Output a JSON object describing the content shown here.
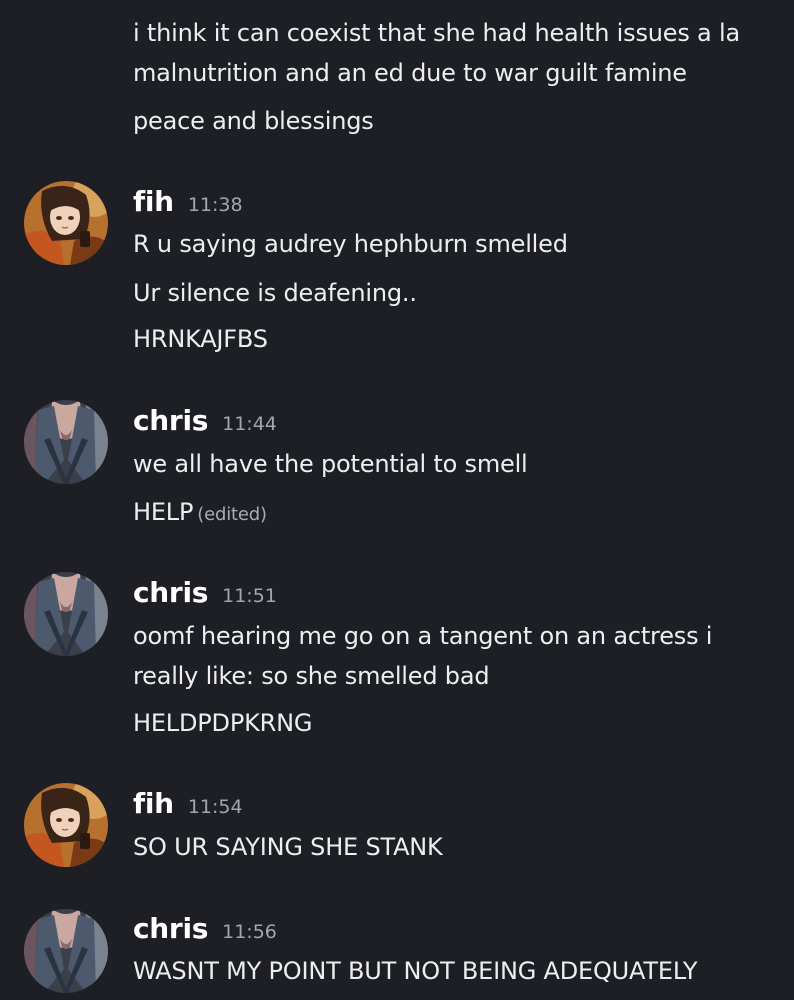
{
  "messages": [
    {
      "continuation": true,
      "lines": [
        {
          "text": "i think it can coexist that she had health issues a la"
        },
        {
          "text": "malnutrition and an ed due to war guilt famine"
        },
        {
          "text": "peace and blessings"
        }
      ]
    },
    {
      "username": "fih",
      "timestamp": "11:38",
      "avatar": "fih-avatar",
      "lines": [
        {
          "text": "R u saying audrey hephburn smelled"
        },
        {
          "text": "Ur silence is deafening.."
        },
        {
          "text": "HRNKAJFBS"
        }
      ]
    },
    {
      "username": "chris",
      "timestamp": "11:44",
      "avatar": "chris-avatar",
      "lines": [
        {
          "text": "we all have the potential to smell"
        },
        {
          "text": "HELP",
          "edited": "(edited)"
        }
      ]
    },
    {
      "username": "chris",
      "timestamp": "11:51",
      "avatar": "chris-avatar",
      "lines": [
        {
          "text": "oomf hearing me go on a tangent on an actress i"
        },
        {
          "text": "really like: so she smelled bad"
        },
        {
          "text": "HELDPDPKRNG"
        }
      ]
    },
    {
      "username": "fih",
      "timestamp": "11:54",
      "avatar": "fih-avatar",
      "lines": [
        {
          "text": "SO UR SAYING SHE STANK"
        }
      ]
    },
    {
      "username": "chris",
      "timestamp": "11:56",
      "avatar": "chris-avatar",
      "lines": [
        {
          "text": "WASNT MY POINT BUT NOT BEING ADEQUATELY"
        }
      ]
    }
  ],
  "colors": {
    "background": "#1e1f24",
    "text": "#eceef1",
    "username": "#ffffff",
    "timestamp": "#a3a6ad"
  }
}
